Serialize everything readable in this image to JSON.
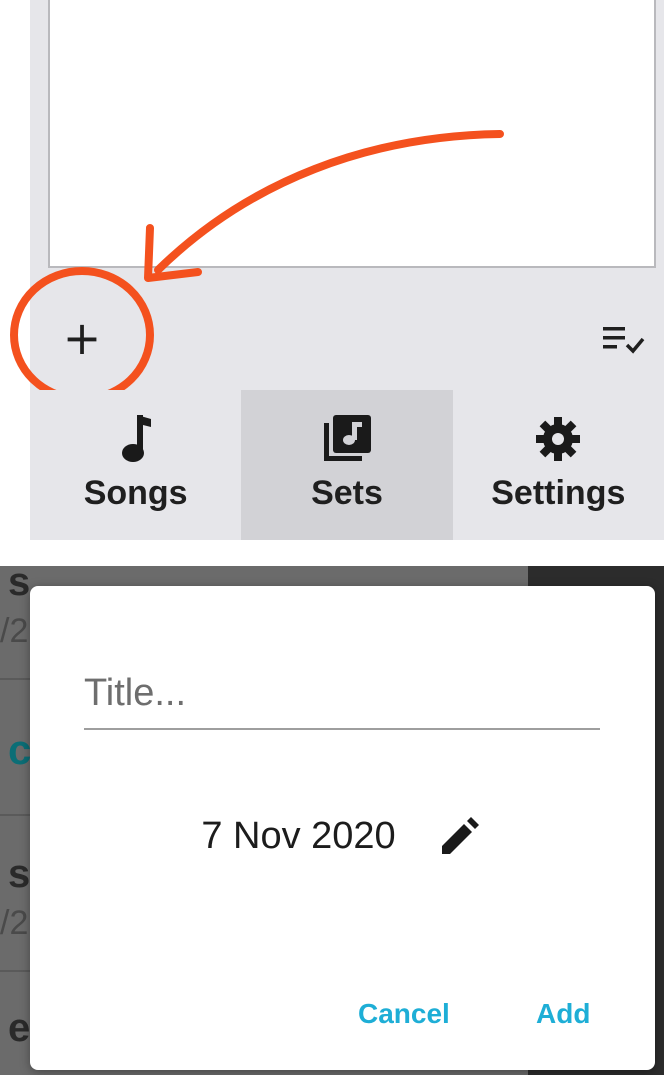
{
  "top": {
    "add_button_symbol": "+",
    "nav": [
      {
        "label": "Songs",
        "icon": "music-note-icon",
        "active": false
      },
      {
        "label": "Sets",
        "icon": "library-music-icon",
        "active": true
      },
      {
        "label": "Settings",
        "icon": "gear-icon",
        "active": false
      }
    ],
    "annotation_color": "#f4511e"
  },
  "dialog": {
    "title_placeholder": "Title...",
    "title_value": "",
    "date": "7 Nov 2020",
    "cancel_label": "Cancel",
    "add_label": "Add",
    "accent_color": "#1eaed6"
  },
  "background_list": {
    "fragments": [
      "s",
      "/2",
      "c",
      "s",
      "/2",
      "e"
    ]
  }
}
